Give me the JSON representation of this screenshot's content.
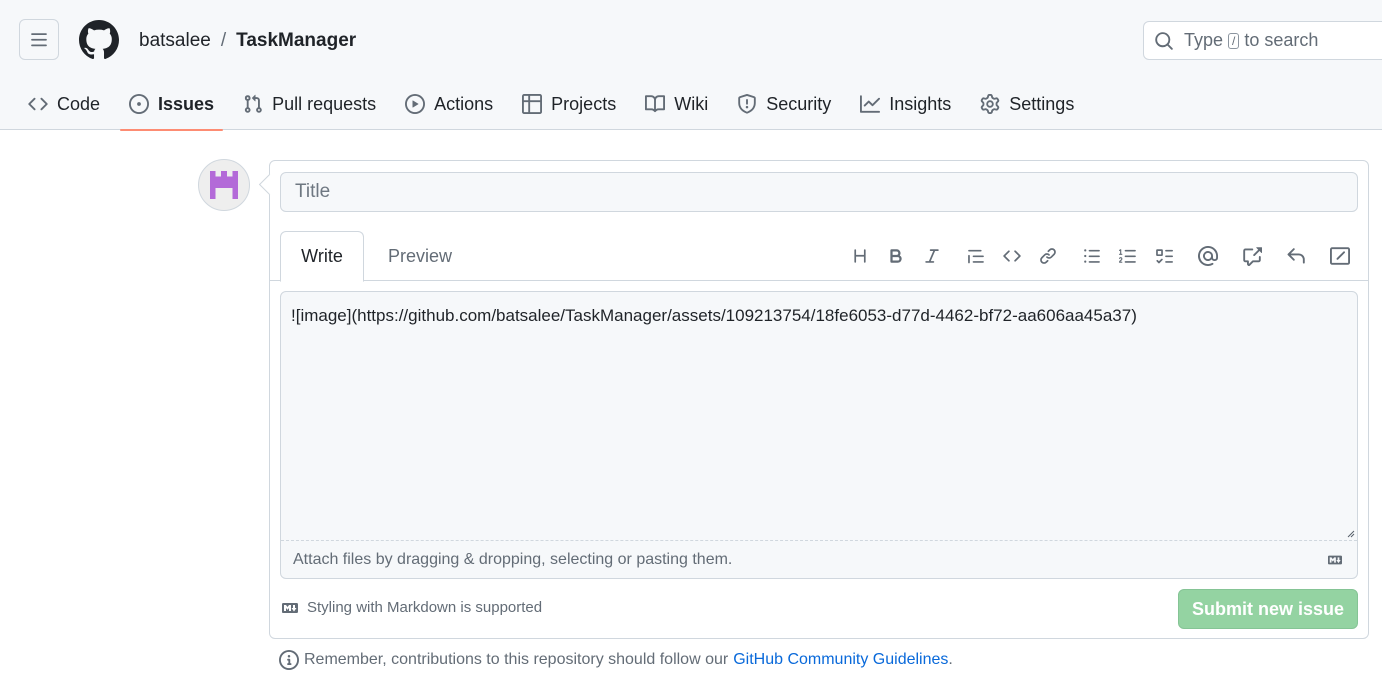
{
  "header": {
    "owner": "batsalee",
    "separator": "/",
    "repo": "TaskManager",
    "search_prefix": "Type",
    "search_key": "/",
    "search_suffix": "to search"
  },
  "nav": {
    "items": [
      {
        "label": "Code",
        "icon": "code-icon"
      },
      {
        "label": "Issues",
        "icon": "issue-opened-icon",
        "active": true
      },
      {
        "label": "Pull requests",
        "icon": "pull-request-icon"
      },
      {
        "label": "Actions",
        "icon": "play-icon"
      },
      {
        "label": "Projects",
        "icon": "table-icon"
      },
      {
        "label": "Wiki",
        "icon": "book-icon"
      },
      {
        "label": "Security",
        "icon": "shield-icon"
      },
      {
        "label": "Insights",
        "icon": "graph-icon"
      },
      {
        "label": "Settings",
        "icon": "gear-icon"
      }
    ]
  },
  "form": {
    "title_placeholder": "Title",
    "tab_write": "Write",
    "tab_preview": "Preview",
    "body_text": "![image](https://github.com/batsalee/TaskManager/assets/109213754/18fe6053-d77d-4462-bf72-aa606aa45a37)",
    "attach_text": "Attach files by dragging & dropping, selecting or pasting them.",
    "markdown_note": "Styling with Markdown is supported",
    "submit_label": "Submit new issue"
  },
  "toolbar": [
    "heading-icon",
    "bold-icon",
    "italic-icon",
    "quote-icon",
    "code-icon",
    "link-icon",
    "unordered-list-icon",
    "ordered-list-icon",
    "task-list-icon",
    "mention-icon",
    "cross-reference-icon",
    "reply-icon",
    "fullscreen-icon"
  ],
  "guidelines": {
    "prefix": "Remember, contributions to this repository should follow our",
    "link": "GitHub Community Guidelines",
    "suffix": "."
  },
  "colors": {
    "accent_underline": "#fd8c73",
    "submit_disabled": "#94d3a2",
    "link": "#0969da",
    "avatar": "#b36ad8"
  }
}
